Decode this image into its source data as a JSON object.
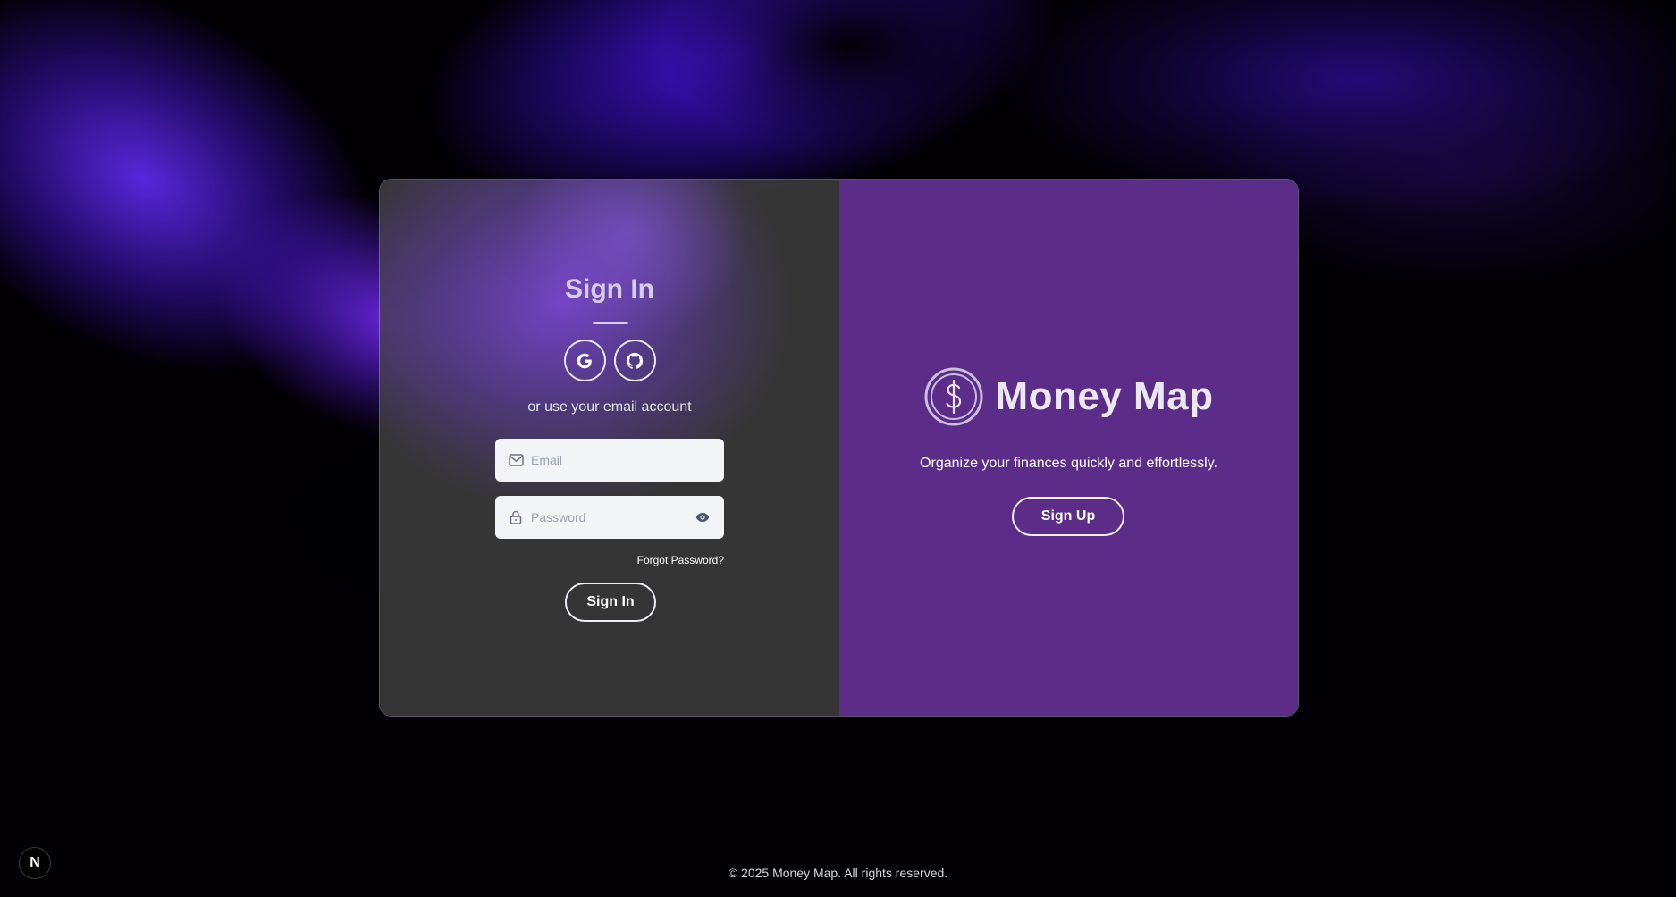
{
  "signin": {
    "title": "Sign In",
    "social": [
      {
        "provider": "google",
        "icon": "google-icon"
      },
      {
        "provider": "github",
        "icon": "github-icon"
      }
    ],
    "alt_text": "or use your email account",
    "email": {
      "placeholder": "Email",
      "value": "",
      "icon": "mail-icon"
    },
    "password": {
      "placeholder": "Password",
      "value": "",
      "icon": "lock-icon",
      "toggle_icon": "eye-icon"
    },
    "forgot_label": "Forgot Password?",
    "button_label": "Sign In"
  },
  "brand": {
    "name": "Money Map",
    "logo_icon": "dollar-coin-icon",
    "tagline": "Organize your finances quickly and effortlessly.",
    "signup_label": "Sign Up"
  },
  "footer": {
    "copyright": "© 2025 Money Map. All rights reserved."
  },
  "badge": {
    "label": "N"
  },
  "colors": {
    "panel_purple": "#5b2d88",
    "panel_dark": "#3c3c3c",
    "accent_glow": "#6a2ee8",
    "input_bg": "#f3f4f6"
  }
}
